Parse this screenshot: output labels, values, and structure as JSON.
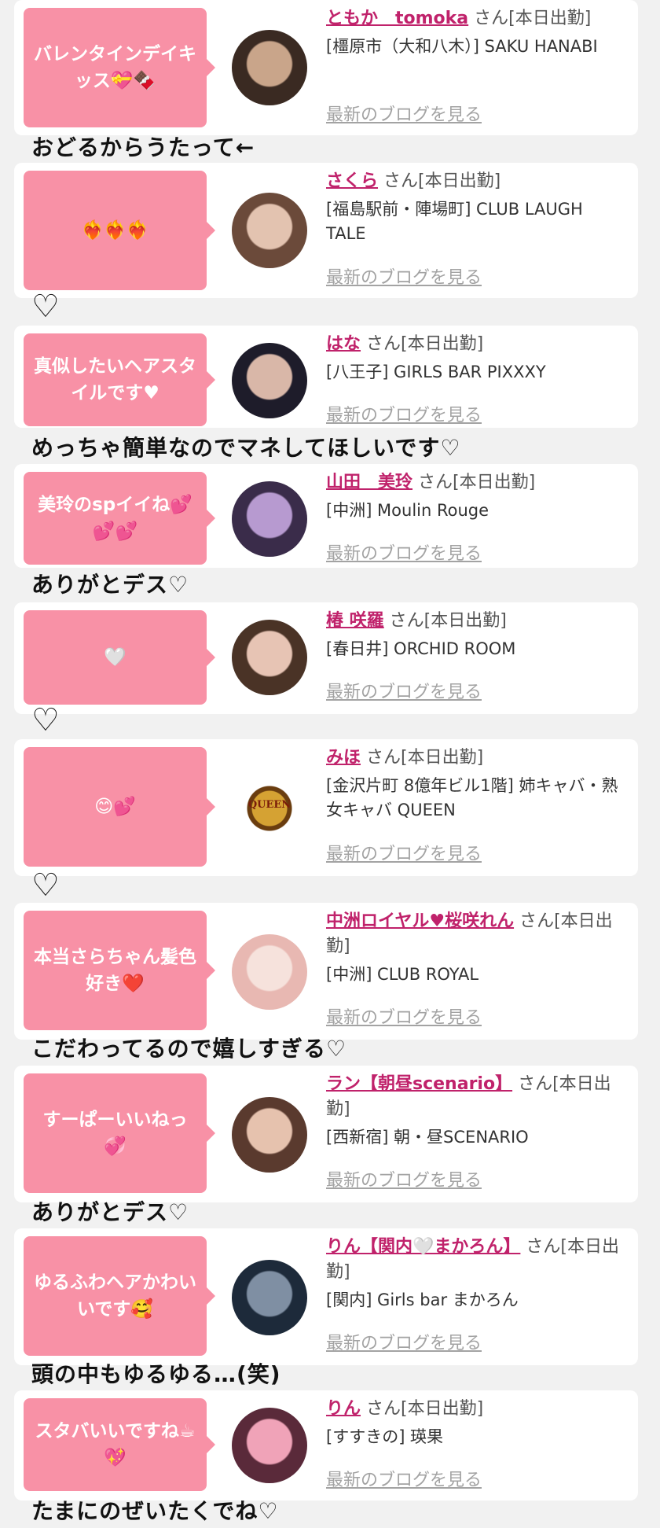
{
  "cards": [
    {
      "message": "バレンタインデイキッス💝🍫",
      "name": "ともか　tomoka",
      "suffix": "さん[本日出勤]",
      "shop": "[橿原市（大和八木）] SAKU HANABI",
      "blog_link": "最新のブログを見る",
      "avatar_colors": [
        "#3a2a22",
        "#c9a58a"
      ],
      "note": "おどるからうたって←"
    },
    {
      "message": "❤️‍🔥❤️‍🔥❤️‍🔥",
      "name": "さくら",
      "suffix": "さん[本日出勤]",
      "shop": "[福島駅前・陣場町] CLUB LAUGH TALE",
      "blog_link": "最新のブログを見る",
      "avatar_colors": [
        "#6b4a3a",
        "#e3c3b0"
      ],
      "note": "♡"
    },
    {
      "message": "真似したいヘアスタイルです♥",
      "name": "はな",
      "suffix": "さん[本日出勤]",
      "shop": "[八王子] GIRLS BAR PIXXXY",
      "blog_link": "最新のブログを見る",
      "avatar_colors": [
        "#1e1c2a",
        "#d9b7a8"
      ],
      "note": "めっちゃ簡単なのでマネしてほしいです♡"
    },
    {
      "message": "美玲のspイイね💕💕💕",
      "name": "山田　美玲",
      "suffix": "さん[本日出勤]",
      "shop": "[中洲] Moulin Rouge",
      "blog_link": "最新のブログを見る",
      "avatar_colors": [
        "#3a2c4a",
        "#b79ad0"
      ],
      "note": "ありがとデス♡"
    },
    {
      "message": "🤍",
      "name": "椿 咲羅",
      "suffix": "さん[本日出勤]",
      "shop": "[春日井] ORCHID ROOM",
      "blog_link": "最新のブログを見る",
      "avatar_colors": [
        "#4a3326",
        "#e7c4b4"
      ],
      "note": "♡"
    },
    {
      "message": "😊💕",
      "name": "みほ",
      "suffix": "さん[本日出勤]",
      "shop": "[金沢片町 8億年ビル1階] 姉キャバ・熟女キャバ QUEEN",
      "blog_link": "最新のブログを見る",
      "avatar_logo": "QUEEN",
      "note": "♡"
    },
    {
      "message": "本当さらちゃん髪色好き❤️",
      "name": "中洲ロイヤル♥桜咲れん",
      "suffix": "さん[本日出勤]",
      "shop": "[中洲] CLUB ROYAL",
      "blog_link": "最新のブログを見る",
      "avatar_colors": [
        "#e8b8b2",
        "#f6e2dc"
      ],
      "note": "こだわってるので嬉しすぎる♡"
    },
    {
      "message": "すーぱーいいねっ💞",
      "name": "ラン【朝昼scenario】",
      "suffix": "さん[本日出勤]",
      "shop": "[西新宿] 朝・昼SCENARIO",
      "blog_link": "最新のブログを見る",
      "avatar_colors": [
        "#5a3a2e",
        "#e6c2ae"
      ],
      "note": "ありがとデス♡"
    },
    {
      "message": "ゆるふわヘアかわいいです🥰",
      "name": "りん【関内🤍まかろん】",
      "suffix": "さん[本日出勤]",
      "shop": "[関内] Girls bar まかろん",
      "blog_link": "最新のブログを見る",
      "avatar_colors": [
        "#1d2a3a",
        "#7f8fa3"
      ],
      "note": "頭の中もゆるゆる…(笑)"
    },
    {
      "message": "スタバいいですね☕💖",
      "name": "りん",
      "suffix": "さん[本日出勤]",
      "shop": "[すすきの] 瑛果",
      "blog_link": "最新のブログを見る",
      "avatar_colors": [
        "#5a2a3a",
        "#f0a3b8"
      ],
      "note": "たまにのぜいたくでね♡"
    }
  ]
}
